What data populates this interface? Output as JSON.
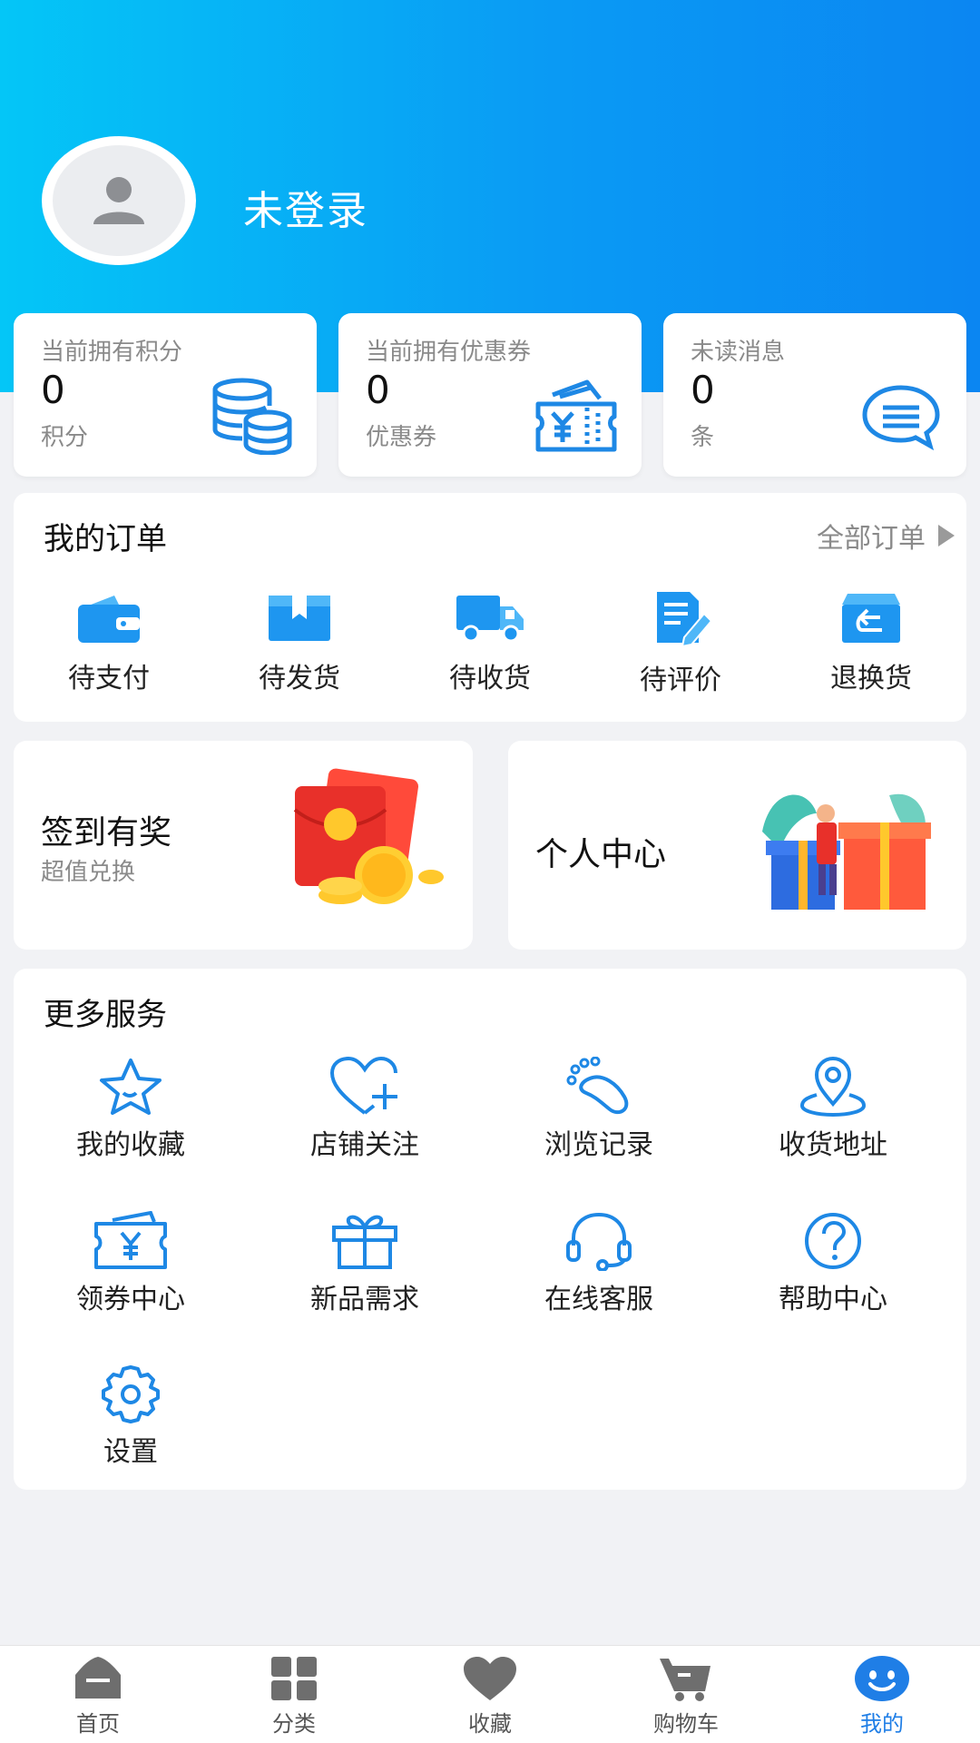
{
  "profile": {
    "login_status": "未登录"
  },
  "stats": [
    {
      "title": "当前拥有积分",
      "value": "0",
      "unit": "积分",
      "icon": "coins-icon"
    },
    {
      "title": "当前拥有优惠券",
      "value": "0",
      "unit": "优惠券",
      "icon": "coupon-ticket-icon"
    },
    {
      "title": "未读消息",
      "value": "0",
      "unit": "条",
      "icon": "message-bubble-icon"
    }
  ],
  "orders": {
    "title": "我的订单",
    "all_label": "全部订单",
    "items": [
      {
        "label": "待支付",
        "icon": "wallet-icon"
      },
      {
        "label": "待发货",
        "icon": "package-box-icon"
      },
      {
        "label": "待收货",
        "icon": "delivery-truck-icon"
      },
      {
        "label": "待评价",
        "icon": "review-edit-icon"
      },
      {
        "label": "退换货",
        "icon": "return-box-icon"
      }
    ]
  },
  "promos": {
    "checkin": {
      "title": "签到有奖",
      "subtitle": "超值兑换",
      "image": "red-envelope-coins-illustration"
    },
    "personal": {
      "title": "个人中心",
      "image": "vip-gift-celebration-illustration"
    }
  },
  "services": {
    "title": "更多服务",
    "items": [
      {
        "label": "我的收藏",
        "icon": "star-icon"
      },
      {
        "label": "店铺关注",
        "icon": "heart-plus-icon"
      },
      {
        "label": "浏览记录",
        "icon": "footprint-icon"
      },
      {
        "label": "收货地址",
        "icon": "location-pin-icon"
      },
      {
        "label": "领券中心",
        "icon": "coupon-icon"
      },
      {
        "label": "新品需求",
        "icon": "gift-icon"
      },
      {
        "label": "在线客服",
        "icon": "headset-icon"
      },
      {
        "label": "帮助中心",
        "icon": "help-question-icon"
      },
      {
        "label": "设置",
        "icon": "gear-icon"
      }
    ]
  },
  "tabbar": {
    "active": "我的",
    "items": [
      {
        "label": "首页",
        "icon": "home-icon"
      },
      {
        "label": "分类",
        "icon": "category-grid-icon"
      },
      {
        "label": "收藏",
        "icon": "heart-icon"
      },
      {
        "label": "购物车",
        "icon": "cart-icon"
      },
      {
        "label": "我的",
        "icon": "smiley-profile-icon"
      }
    ]
  },
  "colors": {
    "header_gradient_start": "#04c6f7",
    "header_gradient_end": "#0b86f2",
    "accent_blue": "#1f7ee6",
    "icon_blue": "#1e88e5",
    "background": "#f1f2f5"
  }
}
